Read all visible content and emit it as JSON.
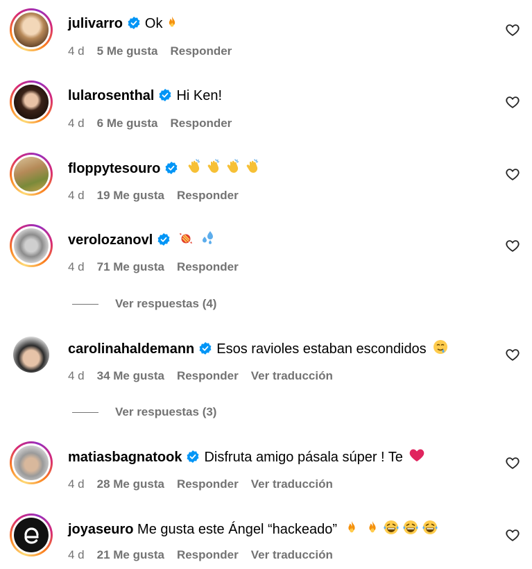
{
  "comments": [
    {
      "user": "julivarro",
      "text": "Ok",
      "age": "4 d",
      "likes": "5 Me gusta",
      "reply": "Responder",
      "translate": ""
    },
    {
      "user": "lularosenthal",
      "text": "Hi Ken!",
      "age": "4 d",
      "likes": "6 Me gusta",
      "reply": "Responder",
      "translate": ""
    },
    {
      "user": "floppytesouro",
      "text": "",
      "age": "4 d",
      "likes": "19 Me gusta",
      "reply": "Responder",
      "translate": ""
    },
    {
      "user": "verolozanovl",
      "text": "",
      "age": "4 d",
      "likes": "71 Me gusta",
      "reply": "Responder",
      "translate": ""
    },
    {
      "user": "carolinahaldemann",
      "text": "Esos ravioles estaban escondidos",
      "age": "4 d",
      "likes": "34 Me gusta",
      "reply": "Responder",
      "translate": "Ver traducción"
    },
    {
      "user": "matiasbagnatook",
      "text": "Disfruta amigo pásala súper ! Te",
      "age": "4 d",
      "likes": "28 Me gusta",
      "reply": "Responder",
      "translate": "Ver traducción"
    },
    {
      "user": "joyaseuro",
      "text": "Me gusta este Ángel “hackeado”",
      "age": "4 d",
      "likes": "21 Me gusta",
      "reply": "Responder",
      "translate": "Ver traducción"
    }
  ],
  "view_replies": [
    {
      "label": "Ver respuestas (4)"
    },
    {
      "label": "Ver respuestas (3)"
    }
  ],
  "icons": {
    "verified": "verified-badge-icon",
    "like": "heart-outline-icon"
  },
  "colors": {
    "verified": "#0095f6",
    "meta": "#737373",
    "heart_red": "#e0245e"
  }
}
